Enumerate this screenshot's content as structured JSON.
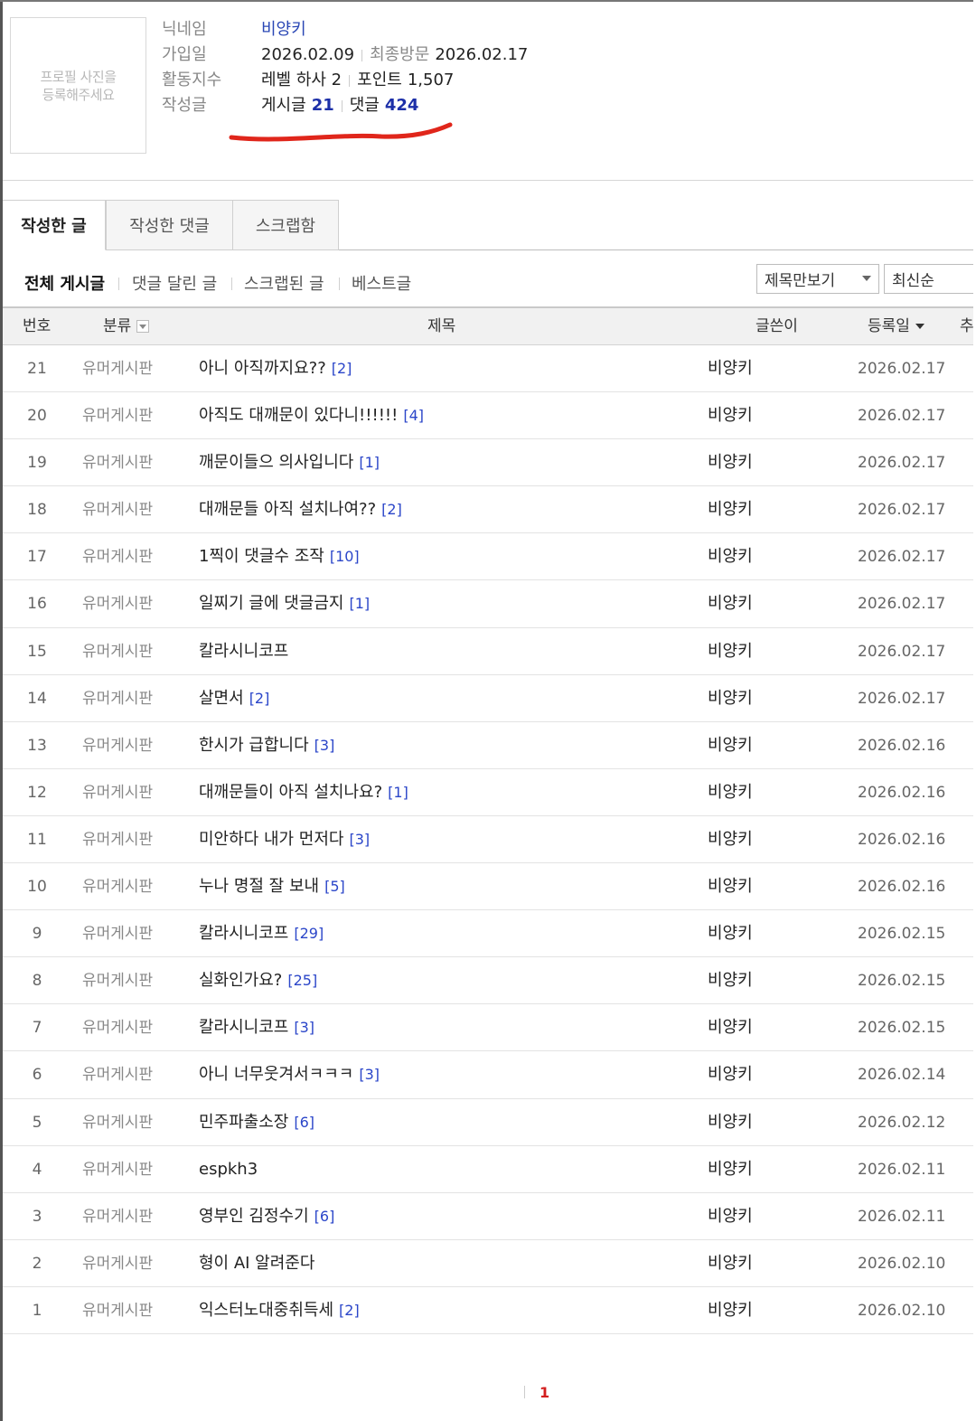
{
  "profile": {
    "photo_placeholder": "프로필 사진을\n등록해주세요",
    "nickname_label": "닉네임",
    "nickname": "비양키",
    "joined_label": "가입일",
    "joined": "2026.02.09",
    "last_visit_label": "최종방문",
    "last_visit": "2026.02.17",
    "activity_label": "활동지수",
    "level": "레벨 하사 2",
    "points_label": "포인트",
    "points": "1,507",
    "written_label": "작성글",
    "posts_label": "게시글",
    "posts_count": "21",
    "comments_label": "댓글",
    "comments_count": "424"
  },
  "tabs": [
    "작성한 글",
    "작성한 댓글",
    "스크랩함"
  ],
  "filters": [
    "전체 게시글",
    "댓글 달린 글",
    "스크랩된 글",
    "베스트글"
  ],
  "view_select": "제목만보기",
  "sort_select": "최신순",
  "table": {
    "headers": {
      "no": "번호",
      "category": "분류",
      "title": "제목",
      "writer": "글쓴이",
      "date": "등록일",
      "extra": "추"
    },
    "rows": [
      {
        "no": "21",
        "category": "유머게시판",
        "title": "아니 아직까지요??",
        "comments": "[2]",
        "writer": "비양키",
        "date": "2026.02.17"
      },
      {
        "no": "20",
        "category": "유머게시판",
        "title": "아직도 대깨문이 있다니!!!!!!",
        "comments": "[4]",
        "writer": "비양키",
        "date": "2026.02.17"
      },
      {
        "no": "19",
        "category": "유머게시판",
        "title": "깨문이들으 의사입니다",
        "comments": "[1]",
        "writer": "비양키",
        "date": "2026.02.17"
      },
      {
        "no": "18",
        "category": "유머게시판",
        "title": "대깨문들 아직 설치나여??",
        "comments": "[2]",
        "writer": "비양키",
        "date": "2026.02.17"
      },
      {
        "no": "17",
        "category": "유머게시판",
        "title": "1찍이 댓글수 조작",
        "comments": "[10]",
        "writer": "비양키",
        "date": "2026.02.17"
      },
      {
        "no": "16",
        "category": "유머게시판",
        "title": "일찌기 글에 댓글금지",
        "comments": "[1]",
        "writer": "비양키",
        "date": "2026.02.17"
      },
      {
        "no": "15",
        "category": "유머게시판",
        "title": "칼라시니코프",
        "comments": "",
        "writer": "비양키",
        "date": "2026.02.17"
      },
      {
        "no": "14",
        "category": "유머게시판",
        "title": "살면서",
        "comments": "[2]",
        "writer": "비양키",
        "date": "2026.02.17"
      },
      {
        "no": "13",
        "category": "유머게시판",
        "title": "한시가 급합니다",
        "comments": "[3]",
        "writer": "비양키",
        "date": "2026.02.16"
      },
      {
        "no": "12",
        "category": "유머게시판",
        "title": "대깨문들이 아직 설치나요?",
        "comments": "[1]",
        "writer": "비양키",
        "date": "2026.02.16"
      },
      {
        "no": "11",
        "category": "유머게시판",
        "title": "미안하다 내가 먼저다",
        "comments": "[3]",
        "writer": "비양키",
        "date": "2026.02.16"
      },
      {
        "no": "10",
        "category": "유머게시판",
        "title": "누나 명절 잘 보내",
        "comments": "[5]",
        "writer": "비양키",
        "date": "2026.02.16"
      },
      {
        "no": "9",
        "category": "유머게시판",
        "title": "칼라시니코프",
        "comments": "[29]",
        "writer": "비양키",
        "date": "2026.02.15"
      },
      {
        "no": "8",
        "category": "유머게시판",
        "title": "실화인가요?",
        "comments": "[25]",
        "writer": "비양키",
        "date": "2026.02.15"
      },
      {
        "no": "7",
        "category": "유머게시판",
        "title": "칼라시니코프",
        "comments": "[3]",
        "writer": "비양키",
        "date": "2026.02.15"
      },
      {
        "no": "6",
        "category": "유머게시판",
        "title": "아니 너무웃겨서ㅋㅋㅋ",
        "comments": "[3]",
        "writer": "비양키",
        "date": "2026.02.14"
      },
      {
        "no": "5",
        "category": "유머게시판",
        "title": "민주파출소장",
        "comments": "[6]",
        "writer": "비양키",
        "date": "2026.02.12"
      },
      {
        "no": "4",
        "category": "유머게시판",
        "title": "espkh3",
        "comments": "",
        "writer": "비양키",
        "date": "2026.02.11"
      },
      {
        "no": "3",
        "category": "유머게시판",
        "title": "영부인 김정수기",
        "comments": "[6]",
        "writer": "비양키",
        "date": "2026.02.11"
      },
      {
        "no": "2",
        "category": "유머게시판",
        "title": "형이 AI 알려준다",
        "comments": "",
        "writer": "비양키",
        "date": "2026.02.10"
      },
      {
        "no": "1",
        "category": "유머게시판",
        "title": "익스터노대중취득세",
        "comments": "[2]",
        "writer": "비양키",
        "date": "2026.02.10"
      }
    ]
  },
  "pagination": {
    "current": "1"
  },
  "colors": {
    "accent_blue": "#2b46c9",
    "underline_red": "#e0261b",
    "page_red": "#d31f1f"
  }
}
